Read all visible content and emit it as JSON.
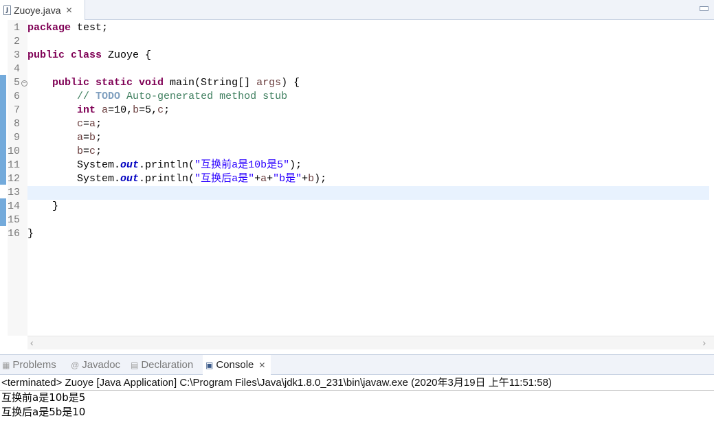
{
  "editor": {
    "tab_title": "Zuoye.java",
    "line_numbers": [
      "1",
      "2",
      "3",
      "4",
      "5",
      "6",
      "7",
      "8",
      "9",
      "10",
      "11",
      "12",
      "13",
      "14",
      "15",
      "16"
    ],
    "code": {
      "l1_kw": "package",
      "l1_rest": " test;",
      "l3_kw": "public class",
      "l3_rest": " Zuoye {",
      "l5_kw": "public static void",
      "l5_mid": " main(String[] ",
      "l5_arg": "args",
      "l5_end": ") {",
      "l6_cm1": "// ",
      "l6_todo": "TODO",
      "l6_cm2": " Auto-generated method stub",
      "l7_kw": "int",
      "l7_v1": "a",
      "l7_t1": "=10,",
      "l7_v2": "b",
      "l7_t2": "=5,",
      "l7_v3": "c",
      "l7_t3": ";",
      "l8_v1": "c",
      "l8_t": "=",
      "l8_v2": "a",
      "l8_e": ";",
      "l9_v1": "a",
      "l9_t": "=",
      "l9_v2": "b",
      "l9_e": ";",
      "l10_v1": "b",
      "l10_t": "=",
      "l10_v2": "c",
      "l10_e": ";",
      "l11_a": "System.",
      "l11_fld": "out",
      "l11_b": ".println(",
      "l11_str": "\"互换前a是10b是5\"",
      "l11_c": ");",
      "l12_a": "System.",
      "l12_fld": "out",
      "l12_b": ".println(",
      "l12_s1": "\"互换后a是\"",
      "l12_p1": "+",
      "l12_v1": "a",
      "l12_p2": "+",
      "l12_s2": "\"b是\"",
      "l12_p3": "+",
      "l12_v2": "b",
      "l12_c": ");",
      "l14": "}",
      "l16": "}"
    }
  },
  "views": {
    "tabs": [
      "Problems",
      "Javadoc",
      "Declaration",
      "Console"
    ],
    "active_tab": "Console"
  },
  "console": {
    "header": "<terminated> Zuoye [Java Application] C:\\Program Files\\Java\\jdk1.8.0_231\\bin\\javaw.exe (2020年3月19日 上午11:51:58)",
    "output": [
      "互换前a是10b是5",
      "互换后a是5b是10"
    ]
  },
  "colors": {
    "keyword": "#7f0055",
    "comment": "#3f7f5f",
    "string": "#2a00ff",
    "field": "#0000c0",
    "current_line": "#e8f2fe"
  }
}
